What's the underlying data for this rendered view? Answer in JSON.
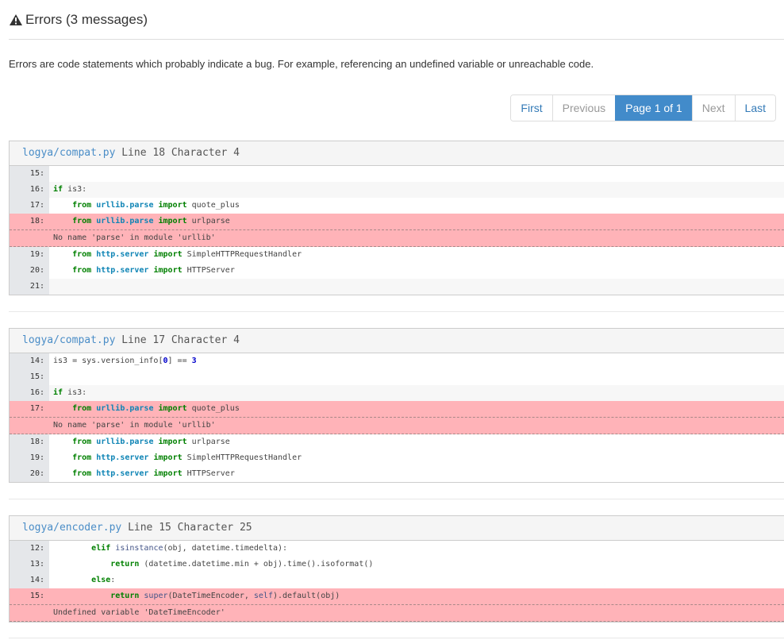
{
  "header": {
    "title": "Errors (3 messages)",
    "icon": "warning-icon"
  },
  "description": "Errors are code statements which probably indicate a bug. For example, referencing an undefined variable or unreachable code.",
  "pagination": {
    "first": "First",
    "previous": "Previous",
    "current": "Page 1 of 1",
    "next": "Next",
    "last": "Last"
  },
  "blocks": [
    {
      "file": "logya/compat.py",
      "location": "Line 18 Character 4",
      "message": "No name 'parse' in module 'urllib'",
      "lines": [
        "15",
        "16",
        "17",
        "18",
        "19",
        "20",
        "21"
      ],
      "code": [
        "",
        "if is3:",
        "    from urllib.parse import quote_plus",
        "    from urllib.parse import urlparse",
        "    from http.server import SimpleHTTPRequestHandler",
        "    from http.server import HTTPServer",
        ""
      ]
    },
    {
      "file": "logya/compat.py",
      "location": "Line 17 Character 4",
      "message": "No name 'parse' in module 'urllib'",
      "lines": [
        "14",
        "15",
        "16",
        "17",
        "18",
        "19",
        "20"
      ],
      "code": [
        "is3 = sys.version_info[0] == 3",
        "",
        "if is3:",
        "    from urllib.parse import quote_plus",
        "    from urllib.parse import urlparse",
        "    from http.server import SimpleHTTPRequestHandler",
        "    from http.server import HTTPServer"
      ]
    },
    {
      "file": "logya/encoder.py",
      "location": "Line 15 Character 25",
      "message": "Undefined variable 'DateTimeEncoder'",
      "lines": [
        "12",
        "13",
        "14",
        "15"
      ],
      "code": [
        "        elif isinstance(obj, datetime.timedelta):",
        "            return (datetime.datetime.min + obj).time().isoformat()",
        "        else:",
        "            return super(DateTimeEncoder, self).default(obj)"
      ]
    }
  ]
}
